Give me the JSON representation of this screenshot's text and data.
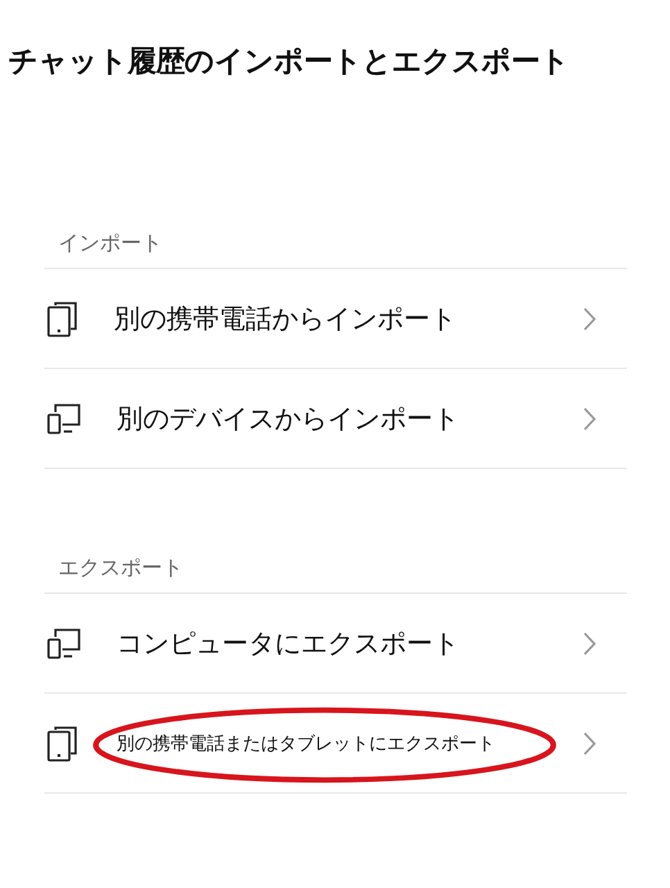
{
  "title": "チャット履歴のインポートとエクスポート",
  "sections": [
    {
      "header": "インポート",
      "rows": [
        {
          "label": "別の携帯電話からインポート",
          "kind": "phone",
          "highlighted": false
        },
        {
          "label": "別のデバイスからインポート",
          "kind": "computer",
          "highlighted": false
        }
      ]
    },
    {
      "header": "エクスポート",
      "rows": [
        {
          "label": "コンピュータにエクスポート",
          "kind": "computer",
          "highlighted": false
        },
        {
          "label": "別の携帯電話またはタブレットにエクスポート",
          "kind": "phone",
          "highlighted": true
        }
      ]
    }
  ]
}
